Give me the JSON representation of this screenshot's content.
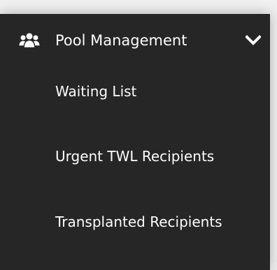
{
  "colors": {
    "sidebar_background": "#262626",
    "text": "#ffffff",
    "page_background": "#f0f0f0"
  },
  "menu": {
    "icon": "users-icon",
    "title": "Pool Management",
    "chevron_icon": "chevron-down-icon",
    "items": [
      {
        "label": "Waiting List"
      },
      {
        "label": "Urgent TWL Recipients"
      },
      {
        "label": "Transplanted Recipients"
      }
    ]
  }
}
